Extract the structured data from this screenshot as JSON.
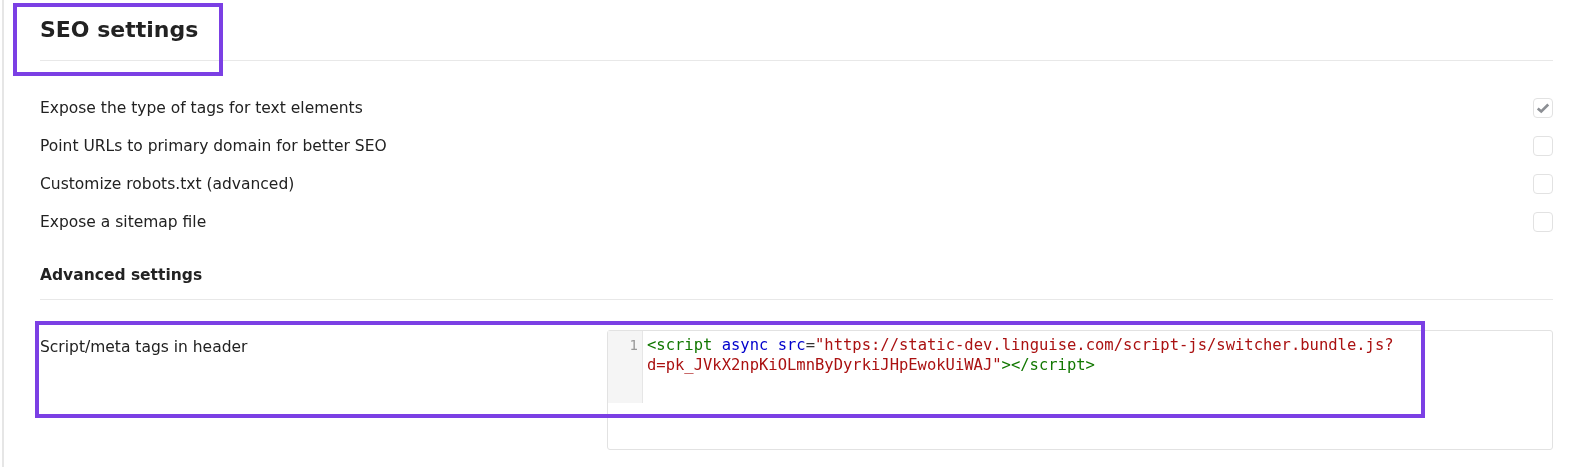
{
  "title": "SEO settings",
  "options": [
    {
      "label": "Expose the type of tags for text elements",
      "checked": true
    },
    {
      "label": "Point URLs to primary domain for better SEO",
      "checked": false
    },
    {
      "label": "Customize robots.txt (advanced)",
      "checked": false
    },
    {
      "label": "Expose a sitemap file",
      "checked": false
    }
  ],
  "advanced": {
    "heading": "Advanced settings",
    "field_label": "Script/meta tags in header",
    "editor": {
      "line_number": "1",
      "rows": [
        [
          {
            "kind": "tag",
            "text": "<script"
          },
          {
            "kind": "plain",
            "text": " "
          },
          {
            "kind": "attr",
            "text": "async"
          },
          {
            "kind": "plain",
            "text": " "
          },
          {
            "kind": "attr",
            "text": "src"
          },
          {
            "kind": "plain",
            "text": "="
          },
          {
            "kind": "string",
            "text": "\"https://static-dev.linguise.com/script-js/switcher.bundle.js?"
          }
        ],
        [
          {
            "kind": "string",
            "text": "d=pk_JVkX2npKiOLmnByDyrkiJHpEwokUiWAJ\""
          },
          {
            "kind": "tag",
            "text": "></script>"
          }
        ]
      ]
    }
  }
}
